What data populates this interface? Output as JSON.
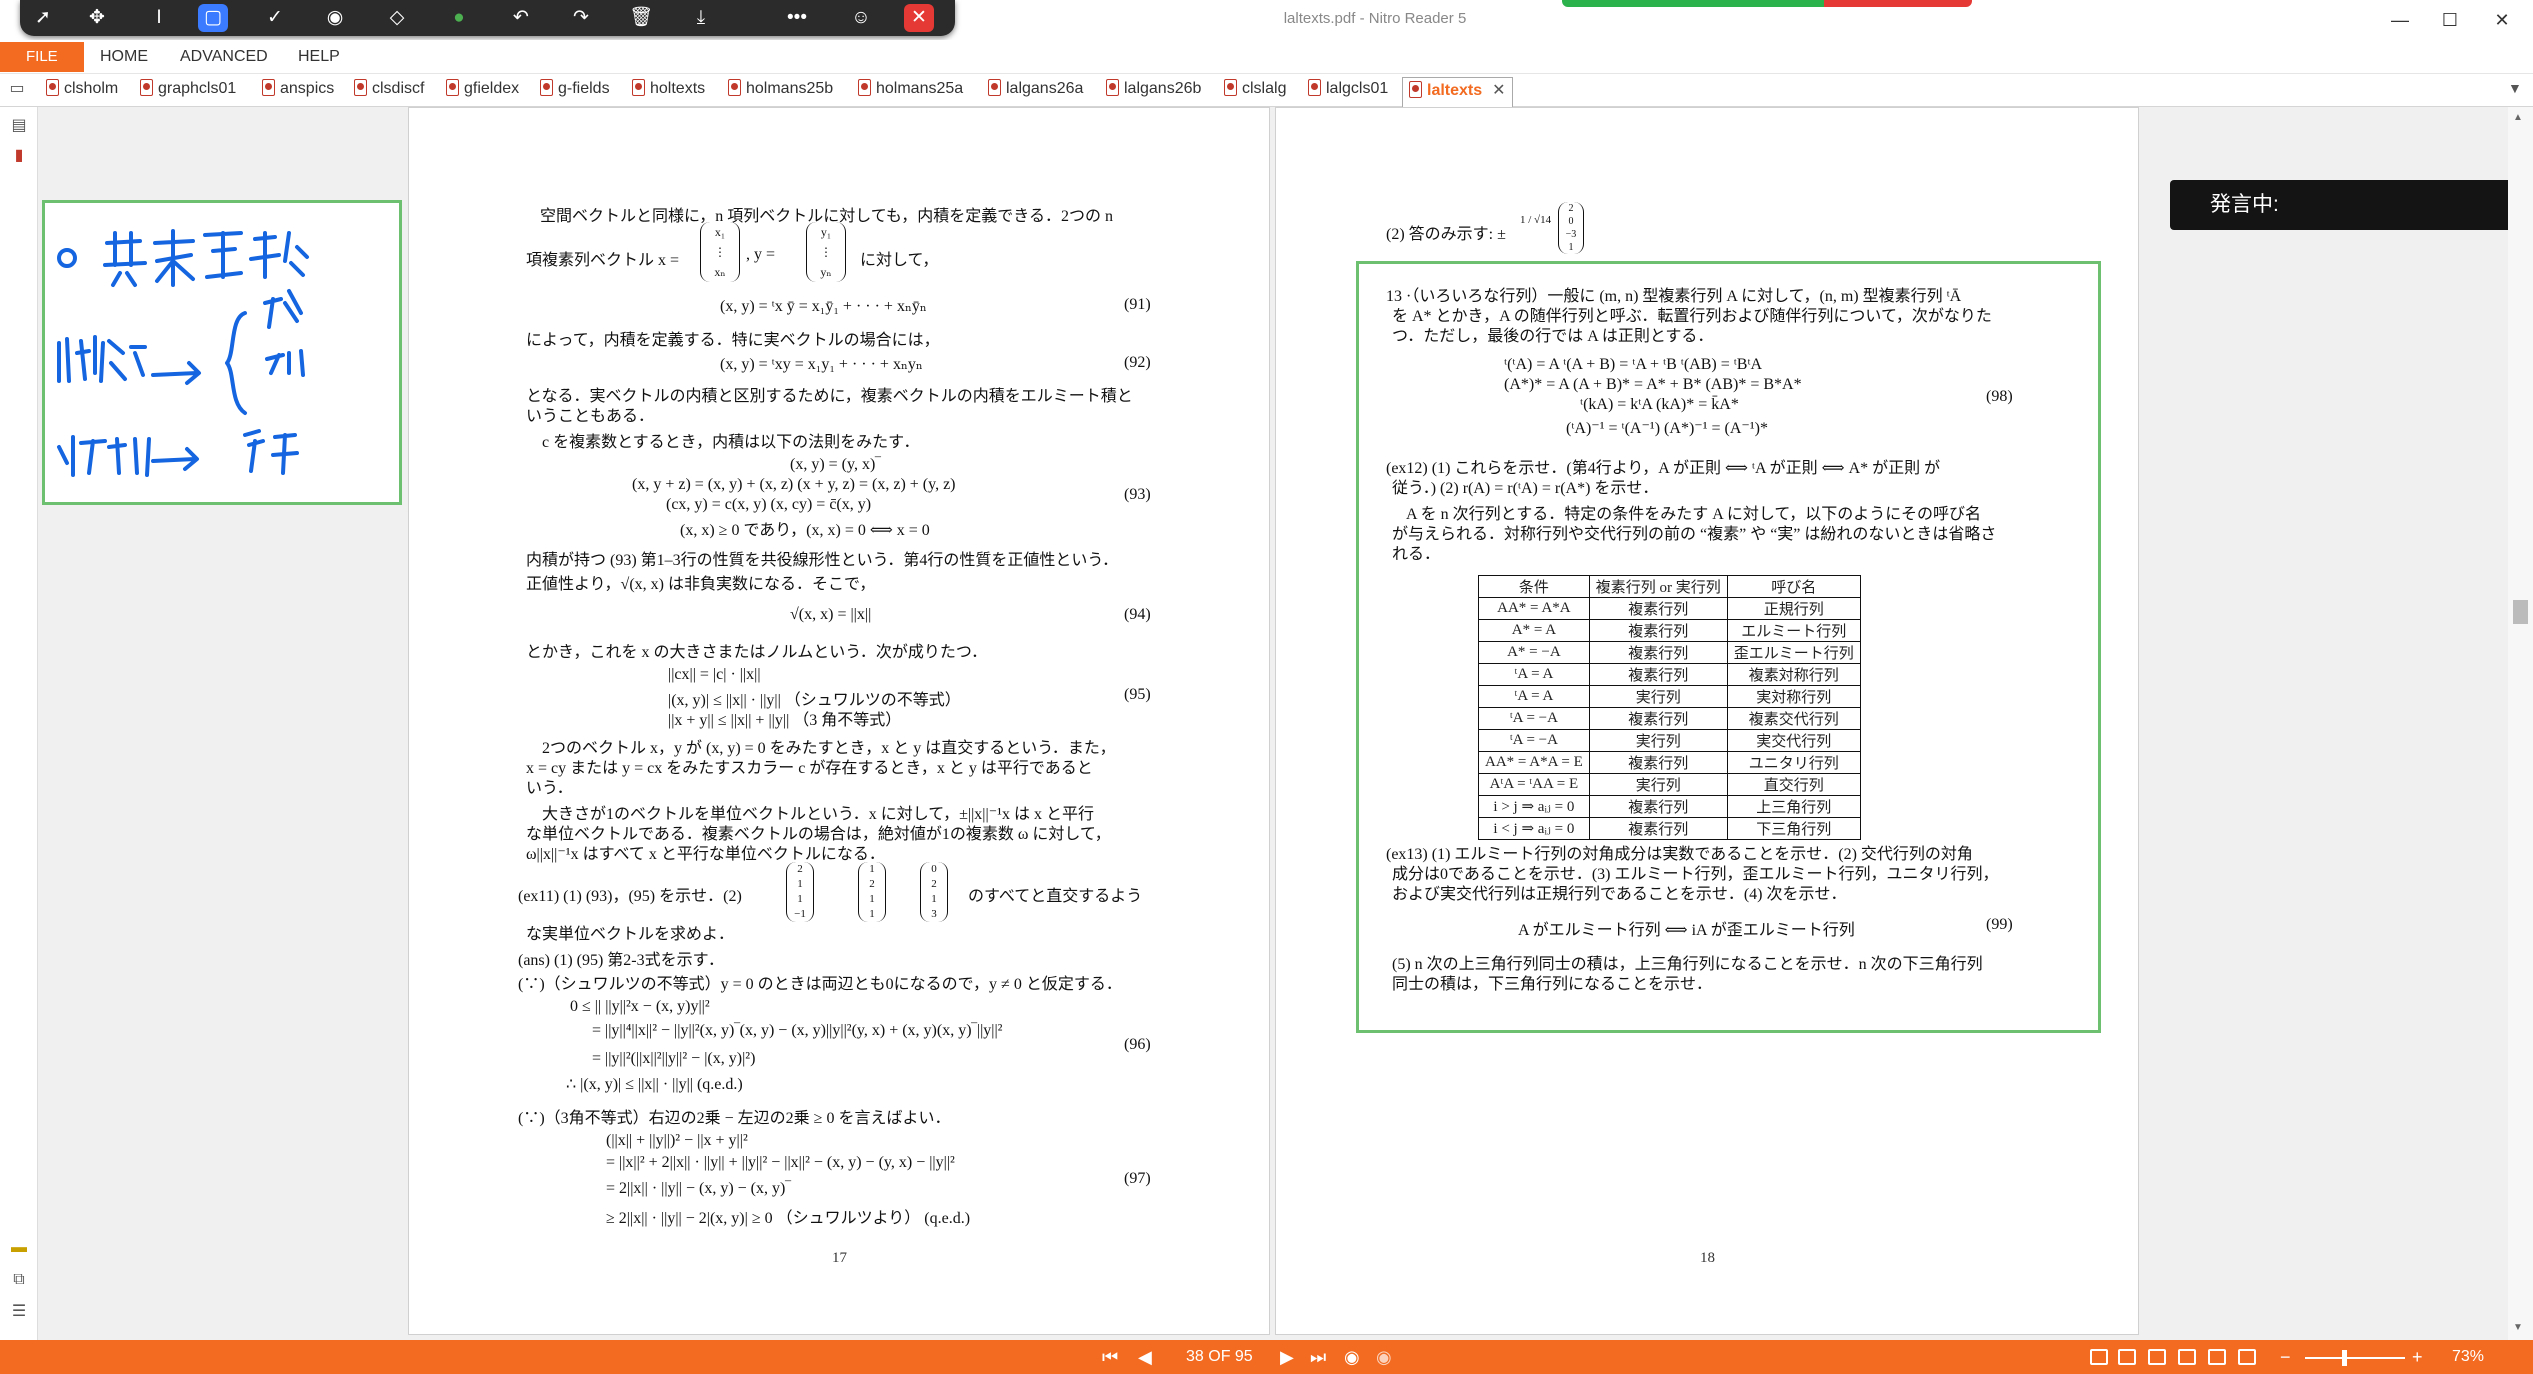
{
  "app": {
    "title": "laltexts.pdf - Nitro Reader 5"
  },
  "floating_toolbar": {
    "icons": [
      "pointer-icon",
      "move-icon",
      "text-cursor-icon",
      "rectangle-icon",
      "check-icon",
      "stamp-icon",
      "eraser-icon",
      "color-dot-icon",
      "undo-icon",
      "redo-icon",
      "trash-icon",
      "download-icon",
      "more-icon",
      "person-icon",
      "close-icon"
    ]
  },
  "window": {
    "minimize": "—",
    "maximize": "☐",
    "close": "✕"
  },
  "menu": {
    "file": "FILE",
    "home": "HOME",
    "advanced": "ADVANCED",
    "help": "HELP"
  },
  "tabs": [
    "clsholm",
    "graphcls01",
    "anspics",
    "clsdiscf",
    "gfieldex",
    "g-fields",
    "holtexts",
    "holmans25b",
    "holmans25a",
    "lalgans26a",
    "lalgans26b",
    "clslalg",
    "lalgcls01",
    "laltexts"
  ],
  "speaking_label": "発言中:",
  "handwritten_note": {
    "lines": [
      "基本変形",
      "階数 → { 行 / 列",
      "逆行列 → 行"
    ]
  },
  "page17": {
    "p1": "空間ベクトルと同様に，n 項列ベクトルに対しても，内積を定義できる．2つの n",
    "p1b": "項複素列ベクトル x =",
    "p1c": ", y =",
    "p1d": "に対して，",
    "eq91": "(x, y) = ᵗx ȳ = x₁ȳ₁ + · · · + xₙȳₙ",
    "n91": "(91)",
    "p2": "によって，内積を定義する．特に実ベクトルの場合には，",
    "eq92": "(x, y) = ᵗxy = x₁y₁ + · · · + xₙyₙ",
    "n92": "(92)",
    "p3a": "となる．実ベクトルの内積と区別するために，複素ベクトルの内積をエルミート積と",
    "p3b": "いうこともある．",
    "p4": "c を複素数とするとき，内積は以下の法則をみたす．",
    "eq93a": "(x, y) = (y, x)‾",
    "eq93b": "(x, y + z) = (x, y) + (x, z)       (x + y, z) = (x, z) + (y, z)",
    "eq93c": "(cx, y) = c(x, y)       (x, cy) = c̄(x, y)",
    "eq93d": "(x, x) ≥ 0   であり，(x, x) = 0 ⟺ x = 0",
    "n93": "(93)",
    "p5a": "内積が持つ (93) 第1–3行の性質を共役線形性という．第4行の性質を正値性という．",
    "p5b": "正値性より，√(x, x) は非負実数になる．そこで，",
    "eq94": "√(x, x) = ||x||",
    "n94": "(94)",
    "p6": "とかき，これを x の大きさまたはノルムという．次が成りたつ．",
    "eq95a": "||cx|| = |c| · ||x||",
    "eq95b": "|(x, y)| ≤ ||x|| · ||y||      （シュワルツの不等式）",
    "eq95c": "||x + y|| ≤ ||x|| + ||y||     （3 角不等式）",
    "n95": "(95)",
    "p7a": "2つのベクトル x，y が (x, y) = 0 をみたすとき，x と y は直交するという．また，",
    "p7b": "x = cy または y = cx をみたすスカラー c が存在するとき，x と y は平行であると",
    "p7c": "いう．",
    "p8a": "大きさが1のベクトルを単位ベクトルという．x に対して，±||x||⁻¹x は x と平行",
    "p8b": "な単位ベクトルである．複素ベクトルの場合は，絶対値が1の複素数 ω に対して，",
    "p8c": "ω||x||⁻¹x はすべて x と平行な単位ベクトルになる．",
    "ex11a": "(ex11) (1) (93)，(95) を示せ．(2)",
    "ex11b": "のすべてと直交するよう",
    "ex11c": "な実単位ベクトルを求めよ．",
    "ans1": "(ans) (1) (95) 第2-3式を示す．",
    "ans2": "(∵)（シュワルツの不等式）y = 0 のときは両辺とも0になるので，y ≠ 0 と仮定する．",
    "eq96a": "0  ≤ || ||y||²x − (x, y)y||²",
    "eq96b": "= ||y||⁴||x||² − ||y||²(x, y)‾(x, y) − (x, y)||y||²(y, x) + (x, y)(x, y)‾||y||²",
    "eq96c": "= ||y||²(||x||²||y||² − |(x, y)|²)",
    "eq96d": "∴  |(x, y)| ≤ ||x|| · ||y||       (q.e.d.)",
    "n96": "(96)",
    "ans3": "(∵)（3角不等式）右辺の2乗 − 左辺の2乗 ≥ 0 を言えばよい．",
    "eq97a": "(||x|| + ||y||)² − ||x + y||²",
    "eq97b": "= ||x||² + 2||x|| · ||y|| + ||y||² − ||x||² − (x, y) − (y, x) − ||y||²",
    "eq97c": "= 2||x|| · ||y|| − (x, y) − (x, y)‾",
    "eq97d": "≥ 2||x|| · ||y|| − 2|(x, y)| ≥ 0    （シュワルツより）     (q.e.d.)",
    "n97": "(97)",
    "mx": [
      "x₁",
      "⋮",
      "xₙ"
    ],
    "my": [
      "y₁",
      "⋮",
      "yₙ"
    ],
    "v1": [
      "2",
      "1",
      "1",
      "−1"
    ],
    "v2": [
      "1",
      "2",
      "1",
      "1"
    ],
    "v3": [
      "0",
      "2",
      "1",
      "3"
    ],
    "pagenum": "17"
  },
  "page18": {
    "top": "(2) 答のみ示す: ±",
    "frac": "1 / √14",
    "v": [
      "2",
      "0",
      "−3",
      "1"
    ],
    "p13a": "13 ·（いろいろな行列）一般に (m, n) 型複素行列 A に対して，(n, m) 型複素行列 ᵗĀ",
    "p13b": "を A* とかき，A の随伴行列と呼ぶ．転置行列および随伴行列について，次がなりた",
    "p13c": "つ．ただし，最後の行では A は正則とする．",
    "eq98a": "ᵗ(ᵗA) = A      ᵗ(A + B) = ᵗA + ᵗB      ᵗ(AB) = ᵗBᵗA",
    "eq98b": "(A*)* = A      (A + B)* = A* + B*      (AB)* = B*A*",
    "eq98c": "ᵗ(kA) = kᵗA              (kA)* = k̄A*",
    "eq98d": "(ᵗA)⁻¹ = ᵗ(A⁻¹)        (A*)⁻¹ = (A⁻¹)*",
    "n98": "(98)",
    "ex12a": "(ex12) (1) これらを示せ．(第4行より，A が正則 ⟺ ᵗA が正則 ⟺ A* が正則 が",
    "ex12b": "従う．) (2) r(A) = r(ᵗA) = r(A*) を示せ．",
    "p14a": "A を n 次行列とする．特定の条件をみたす A に対して，以下のようにその呼び名",
    "p14b": "が与えられる．対称行列や交代行列の前の “複素” や “実” は紛れのないときは省略さ",
    "p14c": "れる．",
    "table": {
      "headers": [
        "条件",
        "複素行列 or 実行列",
        "呼び名"
      ],
      "rows": [
        [
          "AA* = A*A",
          "複素行列",
          "正規行列"
        ],
        [
          "A* = A",
          "複素行列",
          "エルミート行列"
        ],
        [
          "A* = −A",
          "複素行列",
          "歪エルミート行列"
        ],
        [
          "ᵗA = A",
          "複素行列",
          "複素対称行列"
        ],
        [
          "ᵗA = A",
          "実行列",
          "実対称行列"
        ],
        [
          "ᵗA = −A",
          "複素行列",
          "複素交代行列"
        ],
        [
          "ᵗA = −A",
          "実行列",
          "実交代行列"
        ],
        [
          "AA* = A*A = E",
          "複素行列",
          "ユニタリ行列"
        ],
        [
          "AᵗA = ᵗAA = E",
          "実行列",
          "直交行列"
        ],
        [
          "i > j ⇒ aᵢⱼ = 0",
          "複素行列",
          "上三角行列"
        ],
        [
          "i < j ⇒ aᵢⱼ = 0",
          "複素行列",
          "下三角行列"
        ]
      ]
    },
    "ex13a": "(ex13) (1) エルミート行列の対角成分は実数であることを示せ．(2) 交代行列の対角",
    "ex13b": "成分は0であることを示せ．(3) エルミート行列，歪エルミート行列，ユニタリ行列，",
    "ex13c": "および実交代行列は正規行列であることを示せ．(4) 次を示せ．",
    "eq99": "A がエルミート行列 ⟺ iA が歪エルミート行列",
    "n99": "(99)",
    "ex13d": "(5) n 次の上三角行列同士の積は，上三角行列になることを示せ．n 次の下三角行列",
    "ex13e": "同士の積は，下三角行列になることを示せ．",
    "pagenum": "18"
  },
  "status": {
    "page_indicator": "38 OF 95",
    "zoom": "73%",
    "zoom_minus": "−",
    "zoom_plus": "+"
  }
}
